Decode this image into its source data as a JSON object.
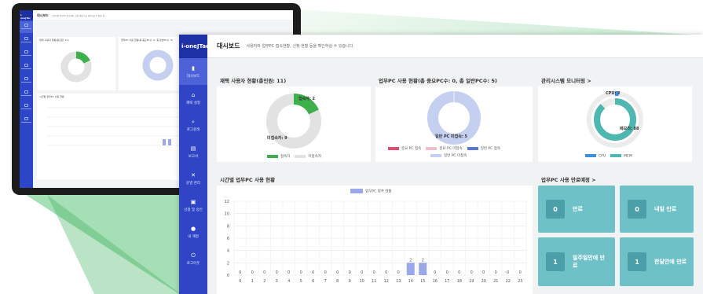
{
  "back_monitor": {
    "logo": "i-oneJTac",
    "title": "대시보드",
    "desc": "사용자와 업무PC 접속현황, 신청 현황 등을 확인하실 수 있습니다.",
    "card1": "재택 사용자 현황(총인원: 11)",
    "card2": "업무PC 사용 현황(총 중요PC수: 0, 총 일반PC수: 5)",
    "card3": "관리시스템 모니터링",
    "card4": "시간별 업무PC 사용 현황"
  },
  "dashboard": {
    "logo": "i-oneJTac",
    "page_title": "대시보드",
    "page_desc": "사용자와 업무PC 접속현황, 신청 현황 등을 확인하실 수 있습니다.",
    "nav": [
      {
        "label": "대시보드",
        "icon": "chart-icon"
      },
      {
        "label": "재택 설정",
        "icon": "home-settings-icon"
      },
      {
        "label": "로그검색",
        "icon": "search-icon"
      },
      {
        "label": "보고서",
        "icon": "report-icon"
      },
      {
        "label": "운영 관리",
        "icon": "tools-icon"
      },
      {
        "label": "신청 및 승인",
        "icon": "approval-icon"
      },
      {
        "label": "내 계정",
        "icon": "user-icon"
      },
      {
        "label": "로그아웃",
        "icon": "power-icon"
      }
    ],
    "remote_users": {
      "title": "재택 사용자 현황(총인원: 11)",
      "connected_label": "접속자: 2",
      "disconnected_label": "미접속자: 9",
      "legend": [
        "접속자",
        "미접속자"
      ]
    },
    "pc_usage": {
      "title": "업무PC 사용 현황(총 중요PC수: 0, 총 일반PC수: 5)",
      "slice_label": "일반 PC 미접속: 5",
      "legend": [
        "중요 PC 접속",
        "중요 PC 미접속",
        "일반 PC 접속",
        "일반 PC 미접속"
      ]
    },
    "monitoring": {
      "title": "관리시스템 모니터링 >",
      "cpu_label": "CPU: 2",
      "mem_label": "메모리: 88",
      "legend": [
        "CPU",
        "MEM"
      ]
    },
    "hourly": {
      "title": "시간별 업무PC 사용 현황",
      "legend": "업무PC 접속 현황"
    },
    "expiry": {
      "title": "업무PC 사용 만료예정 >",
      "tiles": [
        {
          "count": "0",
          "label": "만료"
        },
        {
          "count": "0",
          "label": "내일 만료"
        },
        {
          "count": "1",
          "label": "일주일안에 만료"
        },
        {
          "count": "1",
          "label": "한달안에 만료"
        }
      ]
    }
  },
  "colors": {
    "sidebar": "#2f45c6",
    "green": "#3cb04a",
    "grey": "#e2e2e2",
    "teal": "#4eb8b0",
    "cpu_blue": "#3d8fe0",
    "bar": "#9aa7e8",
    "pc_light": "#c5cff0",
    "tile": "#6fc1c8"
  },
  "chart_data": [
    {
      "type": "pie",
      "title": "재택 사용자 현황(총인원: 11)",
      "categories": [
        "접속자",
        "미접속자"
      ],
      "values": [
        2,
        9
      ]
    },
    {
      "type": "pie",
      "title": "업무PC 사용 현황(총 중요PC수: 0, 총 일반PC수: 5)",
      "categories": [
        "중요 PC 접속",
        "중요 PC 미접속",
        "일반 PC 접속",
        "일반 PC 미접속"
      ],
      "values": [
        0,
        0,
        0,
        5
      ]
    },
    {
      "type": "pie",
      "title": "관리시스템 모니터링",
      "categories": [
        "CPU",
        "MEM"
      ],
      "values": [
        2,
        88
      ]
    },
    {
      "type": "bar",
      "title": "시간별 업무PC 사용 현황",
      "series": [
        {
          "name": "업무PC 접속 현황",
          "values": [
            0,
            0,
            0,
            0,
            0,
            0,
            0,
            0,
            0,
            0,
            0,
            0,
            0,
            0,
            2,
            2,
            0,
            0,
            0,
            0,
            0,
            0,
            0,
            0
          ]
        }
      ],
      "categories": [
        "0",
        "1",
        "2",
        "3",
        "4",
        "5",
        "6",
        "7",
        "8",
        "9",
        "10",
        "11",
        "12",
        "13",
        "14",
        "15",
        "16",
        "17",
        "18",
        "19",
        "20",
        "21",
        "22",
        "23"
      ],
      "yticks": [
        "0",
        "2",
        "4",
        "6",
        "8",
        "10",
        "12"
      ],
      "ylim": [
        0,
        12
      ]
    }
  ]
}
